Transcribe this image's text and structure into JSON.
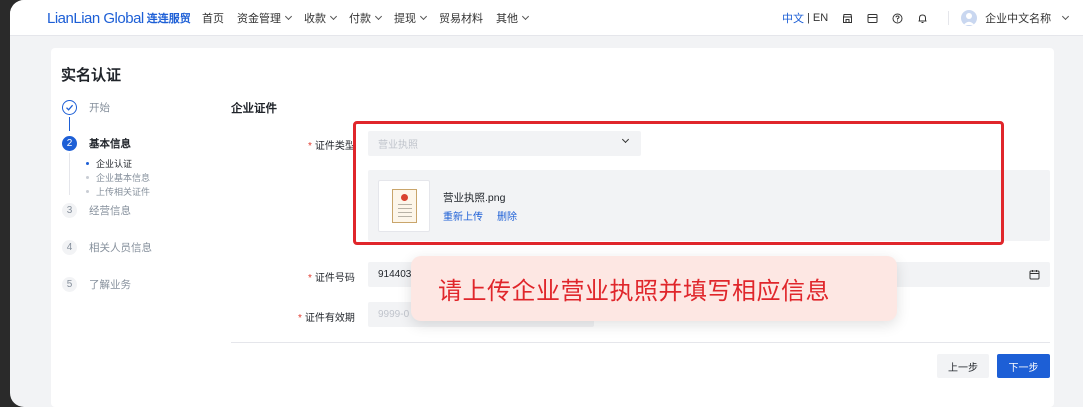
{
  "nav": {
    "logo_text": "LianLian Global",
    "logo_cn": "连连服贸",
    "menu": [
      {
        "label": "首页",
        "has_dropdown": false
      },
      {
        "label": "资金管理",
        "has_dropdown": true
      },
      {
        "label": "收款",
        "has_dropdown": true
      },
      {
        "label": "付款",
        "has_dropdown": true
      },
      {
        "label": "提现",
        "has_dropdown": true
      },
      {
        "label": "贸易材料",
        "has_dropdown": false
      },
      {
        "label": "其他",
        "has_dropdown": true
      }
    ],
    "lang_cn": "中文",
    "lang_sep": "|",
    "lang_en": "EN",
    "icons": [
      "shop-icon",
      "wallet-icon",
      "help-icon",
      "bell-icon"
    ],
    "user_name": "企业中文名称"
  },
  "page": {
    "title": "实名认证"
  },
  "steps": [
    {
      "number": "",
      "label": "开始",
      "state": "done"
    },
    {
      "number": "2",
      "label": "基本信息",
      "state": "active"
    },
    {
      "number": "3",
      "label": "经营信息",
      "state": "todo"
    },
    {
      "number": "4",
      "label": "相关人员信息",
      "state": "todo"
    },
    {
      "number": "5",
      "label": "了解业务",
      "state": "todo"
    }
  ],
  "substeps": [
    {
      "label": "企业认证",
      "state": "active"
    },
    {
      "label": "企业基本信息",
      "state": "todo"
    },
    {
      "label": "上传相关证件",
      "state": "todo"
    }
  ],
  "form": {
    "section_title": "企业证件",
    "required_mark": "*",
    "doc_type_label": "证件类型",
    "doc_type_value": "营业执照",
    "file": {
      "name": "营业执照.png",
      "reupload_label": "重新上传",
      "delete_label": "删除"
    },
    "doc_number_label": "证件号码",
    "doc_number_value": "914403",
    "validity_label": "证件有效期",
    "validity_value": "9999-0"
  },
  "buttons": {
    "prev": "上一步",
    "next": "下一步"
  },
  "annotation": {
    "tooltip_text": "请上传企业营业执照并填写相应信息"
  },
  "colors": {
    "brand": "#1d5fd6",
    "annotation_red": "#e0262b",
    "required_red": "#e13b2f"
  }
}
